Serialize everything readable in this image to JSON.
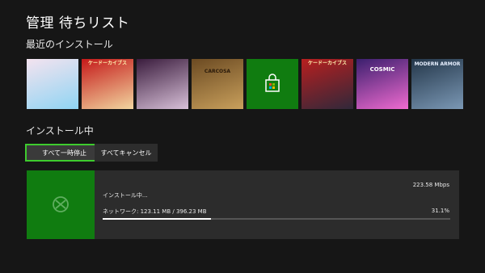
{
  "header": {
    "title": "管理  待ちリスト"
  },
  "recent": {
    "heading": "最近のインストール",
    "tiles": [
      {
        "name": "tile-1",
        "colors": [
          "#f4e3ef",
          "#8fd4f3"
        ]
      },
      {
        "name": "tile-2",
        "caption": "ケードーカイブス",
        "colors": [
          "#c41919",
          "#f2d6a0"
        ]
      },
      {
        "name": "tile-3",
        "colors": [
          "#3a1c3d",
          "#d8c0d8"
        ]
      },
      {
        "name": "tile-4",
        "caption": "CARCOSA",
        "colors": [
          "#6b4a22",
          "#c9a05c"
        ]
      },
      {
        "name": "tile-5",
        "colors": [
          "#107c10",
          "#107c10"
        ]
      },
      {
        "name": "tile-6",
        "caption": "ケードーカイブス",
        "colors": [
          "#b81f1f",
          "#30283a"
        ]
      },
      {
        "name": "tile-7",
        "caption": "COSMIC",
        "colors": [
          "#3b1f6e",
          "#f06bd0"
        ]
      },
      {
        "name": "tile-8",
        "caption": "MODERN ARMOR",
        "colors": [
          "#233649",
          "#7b98b5"
        ]
      }
    ]
  },
  "installing": {
    "heading": "インストール中",
    "pause_all": "すべて一時停止",
    "cancel_all": "すべてキャンセル",
    "item": {
      "status": "インストール中...",
      "speed": "223.58 Mbps",
      "network": "ネットワーク: 123.11 MB / 396.23 MB",
      "percent": "31.1%",
      "progress": 0.311
    }
  },
  "colors": {
    "accent": "#107c10",
    "focus": "#3ecb2e"
  }
}
